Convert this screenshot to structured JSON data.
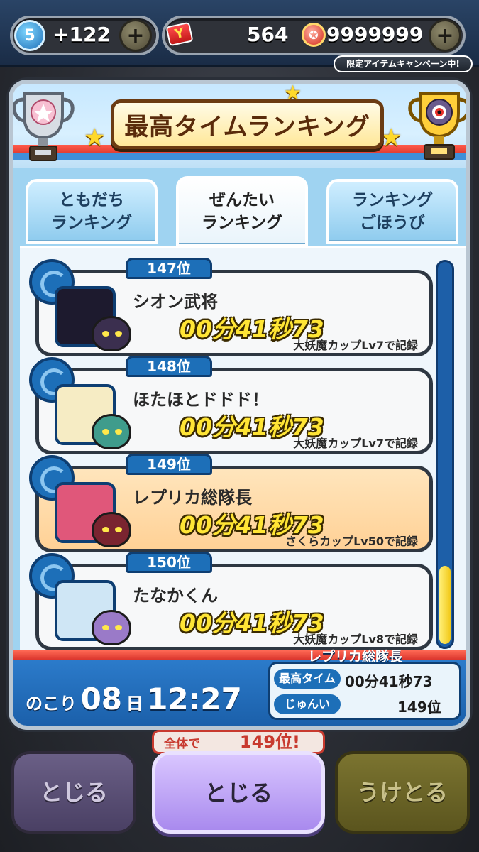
{
  "header": {
    "level": "5",
    "stamina": "+122",
    "tickets": "564",
    "coins": "9999999",
    "campaign": "限定アイテムキャンペーン中!"
  },
  "panel": {
    "title": "最高タイムランキング",
    "tabs": [
      {
        "label": "ともだち\nランキング",
        "active": false
      },
      {
        "label": "ぜんたい\nランキング",
        "active": true
      },
      {
        "label": "ランキング\nごほうび",
        "active": false
      }
    ]
  },
  "entries": [
    {
      "rank": "147位",
      "name": "シオン武将",
      "time": "00分41秒73",
      "record": "大妖魔カップLv7で記録",
      "self": false,
      "avatar_color": "#1d1a2e",
      "yokai_color": "#3b2f4f"
    },
    {
      "rank": "148位",
      "name": "ほたほとドドド！",
      "time": "00分41秒73",
      "record": "大妖魔カップLv7で記録",
      "self": false,
      "avatar_color": "#f6ecc4",
      "yokai_color": "#3f9c8c"
    },
    {
      "rank": "149位",
      "name": "レプリカ総隊長",
      "time": "00分41秒73",
      "record": "さくらカップLv50で記録",
      "self": true,
      "avatar_color": "#e0577a",
      "yokai_color": "#7a2430"
    },
    {
      "rank": "150位",
      "name": "たなかくん",
      "time": "00分41秒73",
      "record": "大妖魔カップLv8で記録",
      "self": false,
      "avatar_color": "#cfe6f5",
      "yokai_color": "#9a7ac8"
    }
  ],
  "footer": {
    "remaining_label": "のこり",
    "days": "08",
    "days_unit": "日",
    "clock": "12:27",
    "player_name": "レプリカ総隊長",
    "best_time_label": "最高タイム",
    "best_time": "00分41秒73",
    "rank_label": "じゅんい",
    "rank": "149位"
  },
  "toast": {
    "prefix": "全体で",
    "rank": "149位!"
  },
  "buttons": {
    "left": "とじる",
    "center": "とじる",
    "right": "うけとる"
  },
  "colors": {
    "accent_blue": "#1d6fb8",
    "self_highlight": "#ffd196",
    "time_yellow": "#ffe535"
  }
}
